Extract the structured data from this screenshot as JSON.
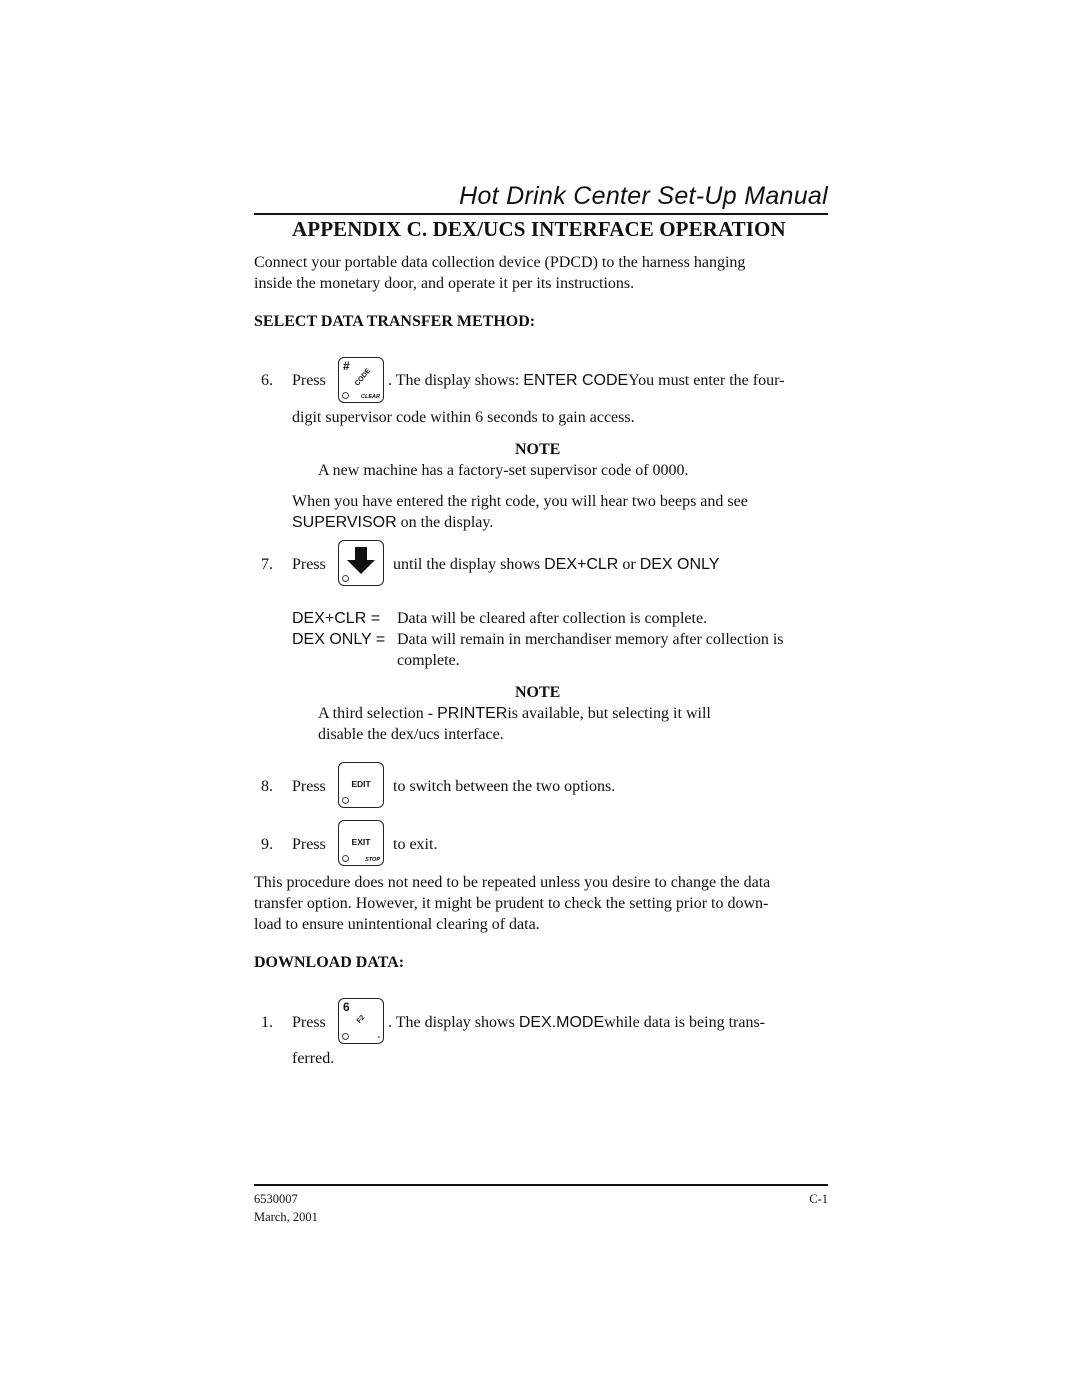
{
  "header": {
    "manual_title": "Hot Drink Center Set-Up Manual",
    "appendix_title": "APPENDIX C.  DEX/UCS INTERFACE OPERATION"
  },
  "intro": {
    "line1": "Connect your portable data collection device (PDCD) to the harness hanging",
    "line2": "inside the monetary door, and operate it per its instructions."
  },
  "select_section": {
    "heading": "SELECT DATA TRANSFER METHOD:",
    "step6": {
      "number": "6.",
      "press": "Press",
      "key": {
        "icon": "code-clear-key-icon",
        "top_char": "#",
        "diag_label": "CODE",
        "corner_label": "CLEAR"
      },
      "text_a": ".  The display shows: ",
      "display": "ENTER CODE",
      "text_b": "You must enter the four-",
      "line2": "digit supervisor code within 6 seconds to gain access."
    },
    "note1": {
      "heading": "NOTE",
      "text": "A new machine has a factory-set supervisor code of 0000."
    },
    "after_code": {
      "line1": "When you have entered the right code, you will hear two beeps and see",
      "display": "SUPERVISOR",
      "line2_rest": "on the display."
    },
    "step7": {
      "number": "7.",
      "press": "Press",
      "key": {
        "icon": "down-arrow-key-icon"
      },
      "text_a": "until the display shows ",
      "display_a": "DEX+CLR",
      "text_or": " or ",
      "display_b": "DEX ONLY"
    },
    "definitions": [
      {
        "term": "DEX+CLR =",
        "desc": "Data will be cleared after collection is complete."
      },
      {
        "term": "DEX ONLY =",
        "desc": "Data will remain in merchandiser memory after collection is",
        "desc2": "complete."
      }
    ],
    "note2": {
      "heading": "NOTE",
      "text_a": "A third selection - ",
      "display": "PRINTER",
      "text_b": "is available, but selecting it will",
      "line2": "disable the dex/ucs interface."
    },
    "step8": {
      "number": "8.",
      "press": "Press",
      "key": {
        "icon": "edit-key-icon",
        "label": "EDIT"
      },
      "text": "to switch between the two options."
    },
    "step9": {
      "number": "9.",
      "press": "Press",
      "key": {
        "icon": "exit-stop-key-icon",
        "label": "EXIT",
        "corner_label": "STOP"
      },
      "text": "to exit."
    },
    "closing": {
      "line1": "This procedure does not need to be repeated unless you desire to change the data",
      "line2": "transfer option.  However, it might be prudent to check the setting prior to down-",
      "line3": "load to ensure unintentional clearing of data."
    }
  },
  "download_section": {
    "heading": "DOWNLOAD DATA:",
    "step1": {
      "number": "1.",
      "press": "Press",
      "key": {
        "icon": "six-f2-key-icon",
        "top_char": "6",
        "diag_label": "F2",
        "corner_label": "-"
      },
      "text_a": ".  The display shows ",
      "display": "DEX.MODE",
      "text_b": "while data is being trans-",
      "line2": "ferred."
    }
  },
  "footer": {
    "doc_number": "6530007",
    "date": "March, 2001",
    "page": "C-1"
  }
}
